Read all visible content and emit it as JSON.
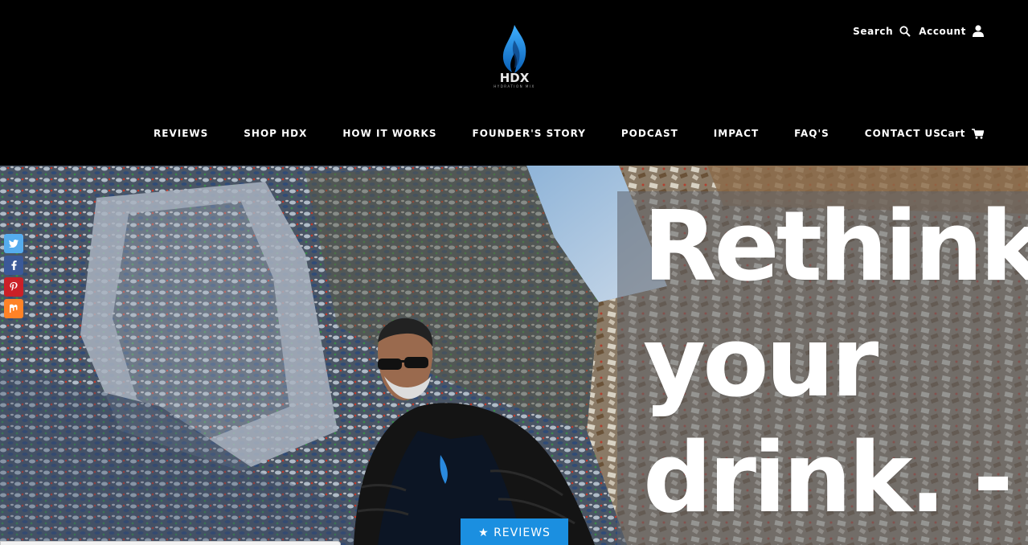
{
  "header": {
    "logo": {
      "text": "HDX",
      "subtext": "HYDRATION MIX"
    },
    "utility": {
      "search_label": "Search",
      "search_icon": "search-icon",
      "account_label": "Account",
      "account_icon": "user-icon"
    },
    "nav": [
      {
        "label": "REVIEWS"
      },
      {
        "label": "SHOP HDX"
      },
      {
        "label": "HOW IT WORKS"
      },
      {
        "label": "FOUNDER'S STORY"
      },
      {
        "label": "PODCAST"
      },
      {
        "label": "IMPACT"
      },
      {
        "label": "FAQ'S"
      },
      {
        "label": "CONTACT US"
      }
    ],
    "cart_label": "Cart",
    "cart_icon": "cart-icon"
  },
  "hero": {
    "headline": [
      "Rethink",
      "your",
      "drink. -"
    ]
  },
  "social": [
    {
      "name": "twitter",
      "color": "#55acee"
    },
    {
      "name": "facebook",
      "color": "#3b5998"
    },
    {
      "name": "pinterest",
      "color": "#cb2027"
    },
    {
      "name": "mix",
      "color": "#ff8226"
    }
  ],
  "reviews_tab": {
    "label": "★ REVIEWS",
    "color": "#1b8fe0"
  },
  "colors": {
    "header_bg": "#000000",
    "flame_blue": "#1e90ff"
  }
}
